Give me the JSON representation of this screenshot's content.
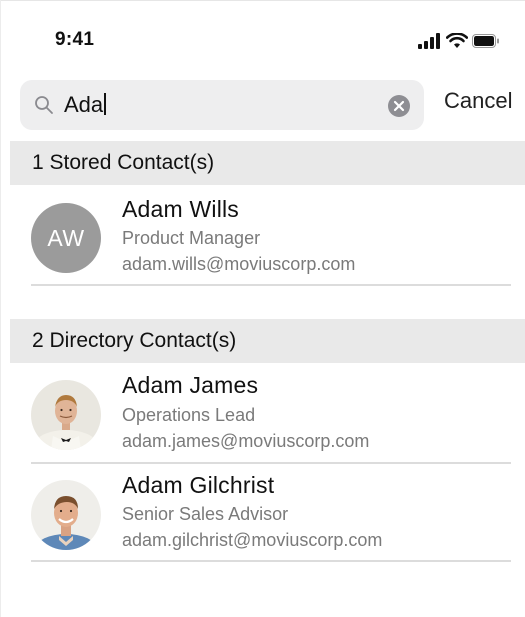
{
  "status_bar": {
    "time": "9:41",
    "icons": [
      "signal-icon",
      "wifi-icon",
      "battery-icon"
    ]
  },
  "search": {
    "query": "Ada",
    "icon": "search-icon",
    "clear_icon": "clear-icon",
    "cancel_label": "Cancel"
  },
  "sections": [
    {
      "title": "1 Stored Contact(s)",
      "contacts": [
        {
          "initials": "AW",
          "name": "Adam Wills",
          "role": "Product Manager",
          "email": "adam.wills@moviuscorp.com"
        }
      ]
    },
    {
      "title": "2 Directory Contact(s)",
      "contacts": [
        {
          "name": "Adam James",
          "role": "Operations Lead",
          "email": "adam.james@moviuscorp.com"
        },
        {
          "name": "Adam Gilchrist",
          "role": "Senior Sales Advisor",
          "email": "adam.gilchrist@moviuscorp.com"
        }
      ]
    }
  ],
  "colors": {
    "search_bg": "#eeeeef",
    "section_bg": "#e9e9e9",
    "initials_avatar_bg": "#9b9b9b",
    "secondary_text": "#7a7a7a"
  }
}
